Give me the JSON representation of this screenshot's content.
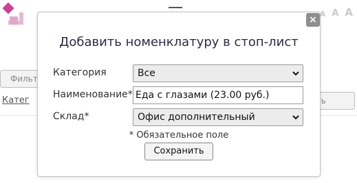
{
  "background": {
    "font_size_options": [
      "A",
      "A",
      "A"
    ],
    "filter_button_label": "Фильт",
    "category_link_text": "Катег",
    "add_button_label": "вить"
  },
  "dialog": {
    "close_symbol": "×",
    "title": "Добавить номенклатуру в стоп-лист",
    "fields": {
      "category": {
        "label": "Категория",
        "value": "Все"
      },
      "name": {
        "label": "Наименование*",
        "value": "Еда с глазами (23.00 руб.)"
      },
      "warehouse": {
        "label": "Склад*",
        "value": "Офис дополнительный"
      }
    },
    "required_note": "* Обязательное поле",
    "save_label": "Сохранить"
  },
  "colors": {
    "logo_top": "#d13e94",
    "logo_bottom": "#e8b9d4",
    "title": "#2b2b45",
    "close_button": "#8e8e8e"
  }
}
